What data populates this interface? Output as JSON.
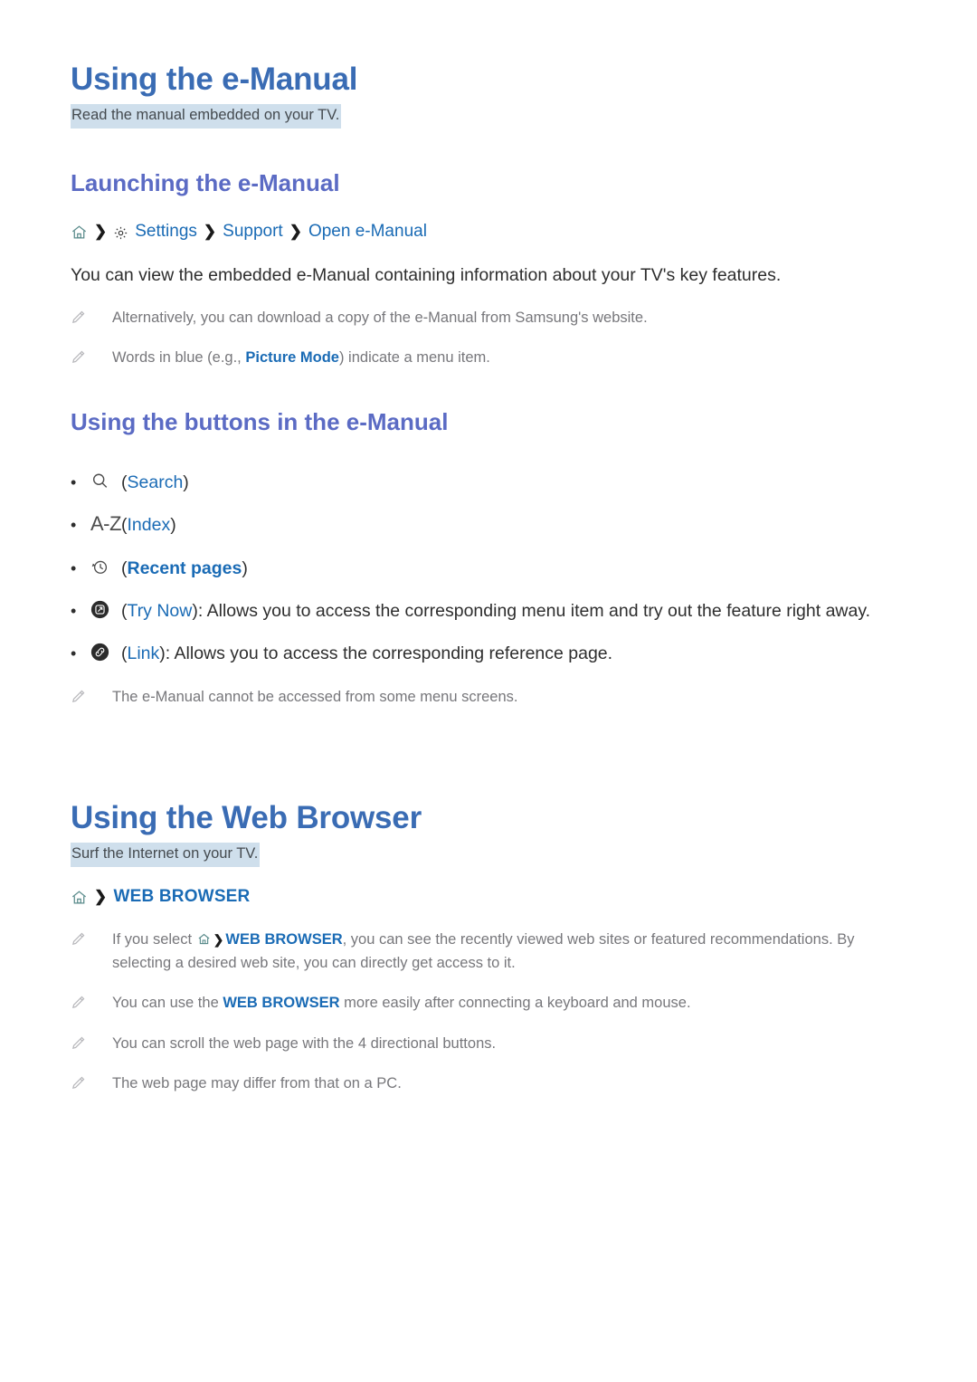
{
  "sections": [
    {
      "title": "Using the e-Manual",
      "lead": "Read the manual embedded on your TV.",
      "subheading": "Launching the e-Manual",
      "breadcrumb": {
        "home_icon": "home-icon",
        "separator": "❯",
        "items": [
          {
            "icon": "gear-icon",
            "label": "Settings"
          },
          {
            "icon": "",
            "label": "Support"
          },
          {
            "icon": "",
            "label": "Open e-Manual"
          }
        ]
      },
      "paragraph": "You can view the embedded e-Manual containing information about your TV's key features.",
      "notes": [
        {
          "icon": "pencil-icon",
          "text": "Alternatively, you can download a copy of the e-Manual from Samsung's website."
        },
        {
          "icon": "pencil-icon",
          "pre": "Words in blue (e.g., ",
          "highlight": "Picture Mode",
          "post": ") indicate a menu item."
        }
      ],
      "buttons_heading": "Using the buttons in the e-Manual",
      "buttons": [
        {
          "icon": "search-icon",
          "open_paren": "(",
          "label": "Search",
          "close_paren": ")",
          "rest": ""
        },
        {
          "icon": "a-z-icon",
          "glyph": "A-Z",
          "open_paren": "(",
          "label": "Index",
          "close_paren": ")",
          "rest": ""
        },
        {
          "icon": "recent-pages-icon",
          "open_paren": "(",
          "label": "Recent pages",
          "close_paren": ")",
          "rest": "",
          "bold": true
        },
        {
          "icon": "try-now-icon",
          "open_paren": "(",
          "label": "Try Now",
          "close_paren": ")",
          "rest": ": Allows you to access the corresponding menu item and try out the feature right away."
        },
        {
          "icon": "link-icon",
          "open_paren": "(",
          "label": "Link",
          "close_paren": ")",
          "rest": ": Allows you to access the corresponding reference page."
        }
      ],
      "buttons_note": {
        "icon": "pencil-icon",
        "text": "The e-Manual cannot be accessed from some menu screens."
      }
    },
    {
      "title": "Using the Web Browser",
      "lead": "Surf the Internet on your TV.",
      "breadcrumb": {
        "home_icon": "home-icon",
        "separator": "❯",
        "label": "WEB BROWSER"
      },
      "notes": [
        {
          "icon": "pencil-icon",
          "pre": "If you select ",
          "inline_home": true,
          "inline_sep": "❯",
          "highlight": "WEB BROWSER",
          "post": ", you can see the recently viewed web sites or featured recommendations. By selecting a desired web site, you can directly get access to it."
        },
        {
          "icon": "pencil-icon",
          "pre": "You can use the ",
          "highlight": "WEB BROWSER",
          "post": " more easily after connecting a keyboard and mouse."
        },
        {
          "icon": "pencil-icon",
          "text": "You can scroll the web page with the 4 directional buttons."
        },
        {
          "icon": "pencil-icon",
          "text": "The web page may differ from that on a PC."
        }
      ]
    }
  ],
  "colors": {
    "heading_blue": "#3a6cb4",
    "subheading_purple": "#5b6bc4",
    "link_blue": "#1a6bb5",
    "highlight_band": "#cfdfec",
    "body_text": "#2e2e2e",
    "note_text": "#77777b",
    "home_icon_teal": "#5b8c8c"
  },
  "bullet_char": "•"
}
